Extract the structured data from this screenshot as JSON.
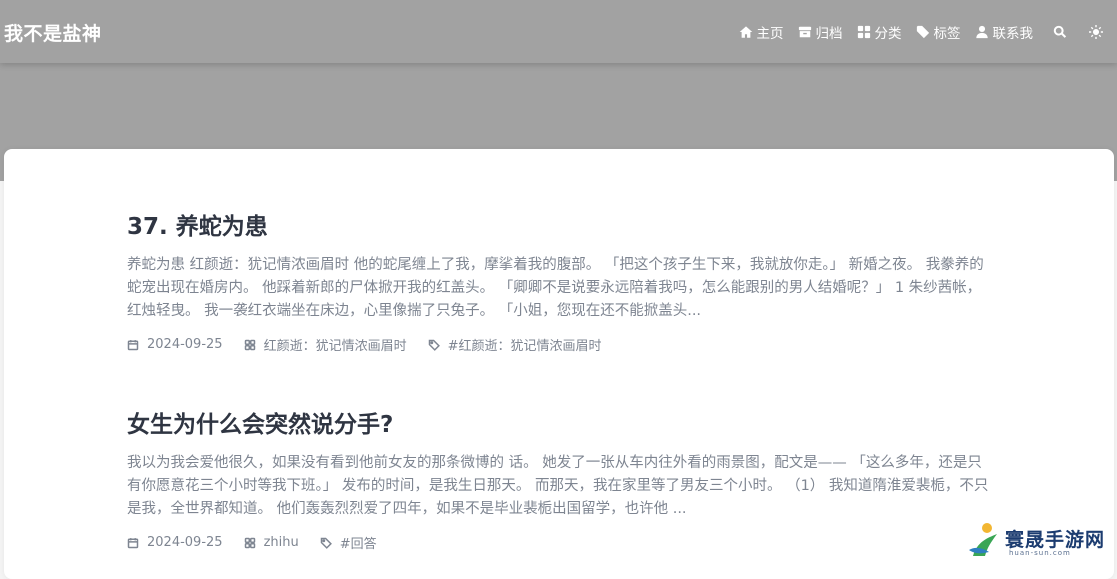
{
  "site": {
    "title": "我不是盐神"
  },
  "nav": {
    "items": [
      {
        "label": "主页",
        "icon": "home-icon"
      },
      {
        "label": "归档",
        "icon": "archive-icon"
      },
      {
        "label": "分类",
        "icon": "category-icon"
      },
      {
        "label": "标签",
        "icon": "tag-icon"
      },
      {
        "label": "联系我",
        "icon": "user-icon"
      }
    ],
    "search_icon": "search-icon",
    "theme_icon": "sun-icon"
  },
  "posts": [
    {
      "title": "37. 养蛇为患",
      "excerpt": "养蛇为患 红颜逝：犹记情浓画眉时 他的蛇尾缠上了我，摩挲着我的腹部。 「把这个孩子生下来，我就放你走。」 新婚之夜。 我豢养的蛇宠出现在婚房内。 他踩着新郎的尸体掀开我的红盖头。 「卿卿不是说要永远陪着我吗，怎么能跟别的男人结婚呢？」 1 朱纱茜帐，红烛轻曳。 我一袭红衣端坐在床边，心里像揣了只兔子。 「小姐，您现在还不能掀盖头...",
      "date": "2024-09-25",
      "category": "红颜逝：犹记情浓画眉时",
      "tag": "#红颜逝：犹记情浓画眉时"
    },
    {
      "title": "女生为什么会突然说分手?",
      "excerpt": "我以为我会爱他很久，如果没有看到他前女友的那条微博的 话。 她发了一张从车内往外看的雨景图，配文是—— 「这么多年，还是只有你愿意花三个小时等我下班。」 发布的时间，是我生日那天。 而那天，我在家里等了男友三个小时。 （1） 我知道隋淮爱裴栀，不只是我，全世界都知道。 他们轰轰烈烈爱了四年，如果不是毕业裴栀出国留学，也许他 ...",
      "date": "2024-09-25",
      "category": "zhihu",
      "tag": "#回答"
    }
  ],
  "watermark": {
    "name": "寰晟手游网",
    "domain": "huan-sun.com"
  },
  "colors": {
    "navbar": "#a2a2a2",
    "title": "#2f3542",
    "text": "#7e8591",
    "card": "#ffffff"
  }
}
